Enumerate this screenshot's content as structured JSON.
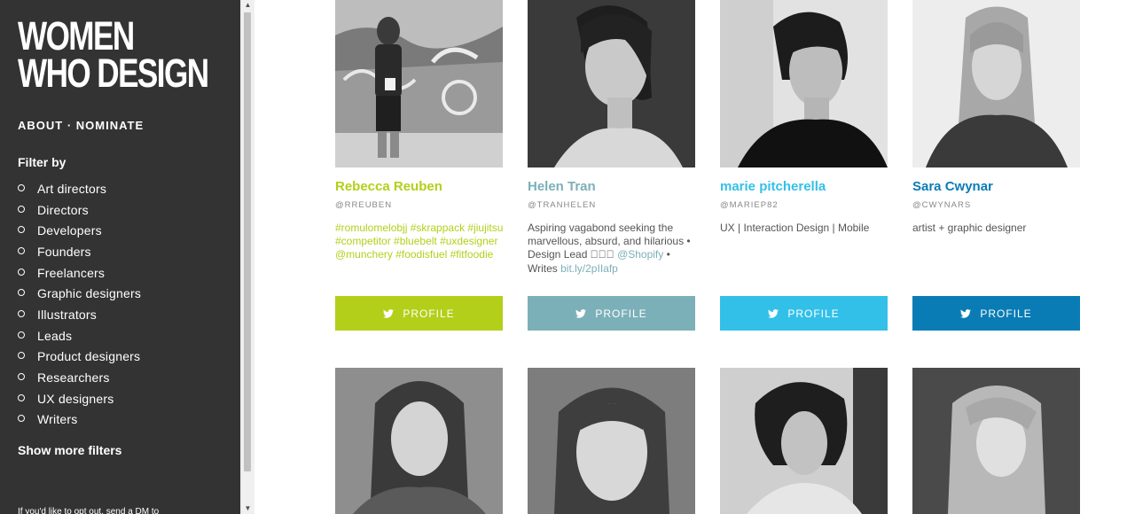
{
  "sidebar": {
    "logo_line1": "WOMEN",
    "logo_line2": "WHO DESIGN",
    "nav_about": "ABOUT",
    "nav_sep": " · ",
    "nav_nominate": "NOMINATE",
    "filter_title": "Filter by",
    "filters": [
      {
        "label": "Art directors"
      },
      {
        "label": "Directors"
      },
      {
        "label": "Developers"
      },
      {
        "label": "Founders"
      },
      {
        "label": "Freelancers"
      },
      {
        "label": "Graphic designers"
      },
      {
        "label": "Illustrators"
      },
      {
        "label": "Leads"
      },
      {
        "label": "Product designers"
      },
      {
        "label": "Researchers"
      },
      {
        "label": "UX designers"
      },
      {
        "label": "Writers"
      }
    ],
    "show_more": "Show more filters",
    "optout_text": "If you'd like to opt out, send a DM to"
  },
  "scrollbar": {
    "up_arrow": "▲",
    "down_arrow": "▼"
  },
  "cards": [
    {
      "name": "Rebecca Reuben",
      "handle": "@RREUBEN",
      "bio_tags": "#romulomelobjj #skrappack #jiujitsu #competitor #bluebelt #uxdesigner @munchery #foodisfuel #fitfoodie",
      "accent": "#b4cf1a",
      "profile_label": "PROFILE",
      "icon": "twitter-bird-icon"
    },
    {
      "name": "Helen Tran",
      "handle": "@TRANHELEN",
      "bio_text": "Aspiring vagabond seeking the marvellous, absurd, and hilarious • Design Lead ⃞⃞⃞ ",
      "bio_link1": "@Shopify",
      "bio_mid": " • Writes ",
      "bio_link2": "bit.ly/2pIIafp",
      "accent": "#7cb0b8",
      "profile_label": "PROFILE",
      "icon": "twitter-bird-icon"
    },
    {
      "name": "marie pitcherella",
      "handle": "@MARIEP82",
      "bio_text": "UX | Interaction Design | Mobile",
      "accent": "#33c0e8",
      "profile_label": "PROFILE",
      "icon": "twitter-bird-icon"
    },
    {
      "name": "Sara Cwynar",
      "handle": "@CWYNARS",
      "bio_text": "artist + graphic designer",
      "accent": "#0a7cb5",
      "profile_label": "PROFILE",
      "icon": "twitter-bird-icon"
    }
  ],
  "colors": {
    "sidebar_bg": "#333333",
    "bio_text": "#555555",
    "handle_text": "#888888"
  }
}
